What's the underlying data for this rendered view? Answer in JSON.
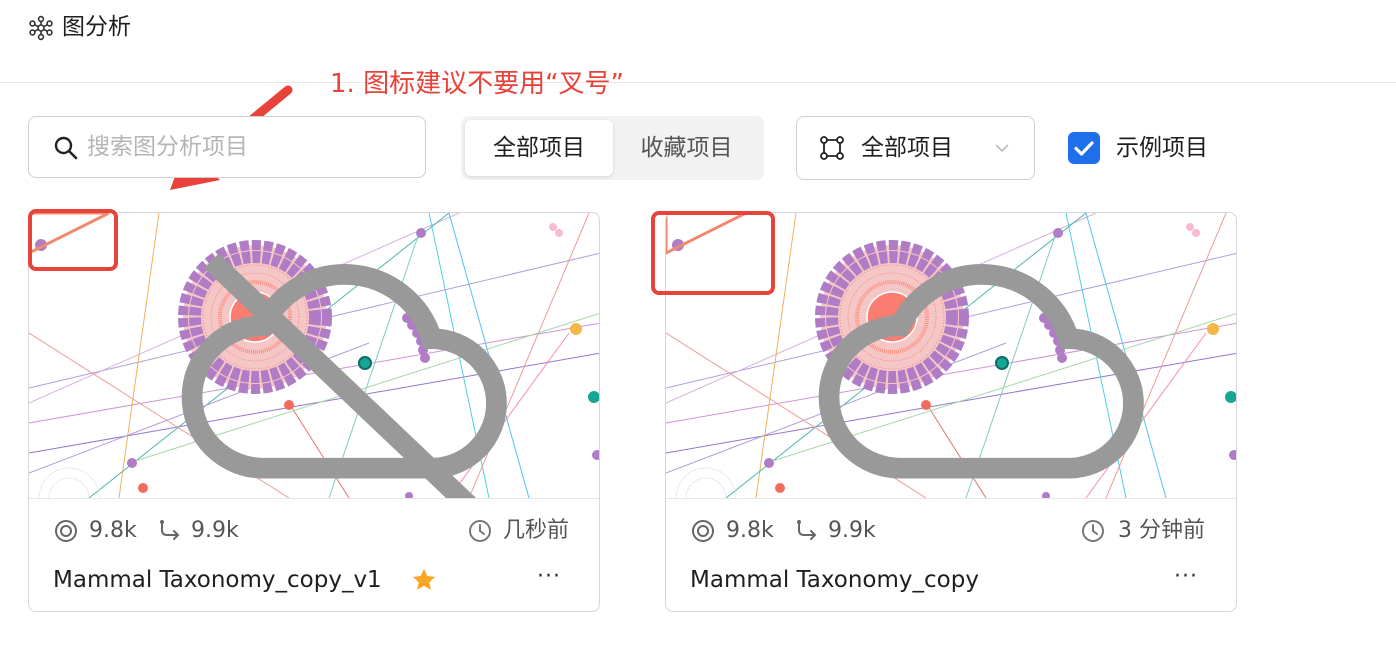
{
  "app": {
    "title": "图分析",
    "icon": "graph-analysis-icon"
  },
  "annotation": {
    "text": "1. 图标建议不要用“叉号”",
    "color": "#e8423a"
  },
  "toolbar": {
    "search": {
      "placeholder": "搜索图分析项目",
      "icon": "search-icon"
    },
    "tabs": [
      {
        "label": "全部项目",
        "active": true
      },
      {
        "label": "收藏项目",
        "active": false
      }
    ],
    "filter": {
      "icon": "graph-nodes-icon",
      "selected": "全部项目"
    },
    "example": {
      "label": "示例项目",
      "checked": true,
      "color": "#1f6feb"
    }
  },
  "cards": [
    {
      "name": "Mammal Taxonomy_copy_v1",
      "nodes": "9.8k",
      "edges": "9.9k",
      "time": "几秒前",
      "starred": true,
      "status_icon": "cloud-off-icon"
    },
    {
      "name": "Mammal Taxonomy_copy",
      "nodes": "9.8k",
      "edges": "9.9k",
      "time": "3 分钟前",
      "starred": false,
      "status_icon": "cloud-icon"
    }
  ],
  "colors": {
    "accent": "#1f6feb",
    "annotation": "#e8423a",
    "star": "#f5a623"
  }
}
